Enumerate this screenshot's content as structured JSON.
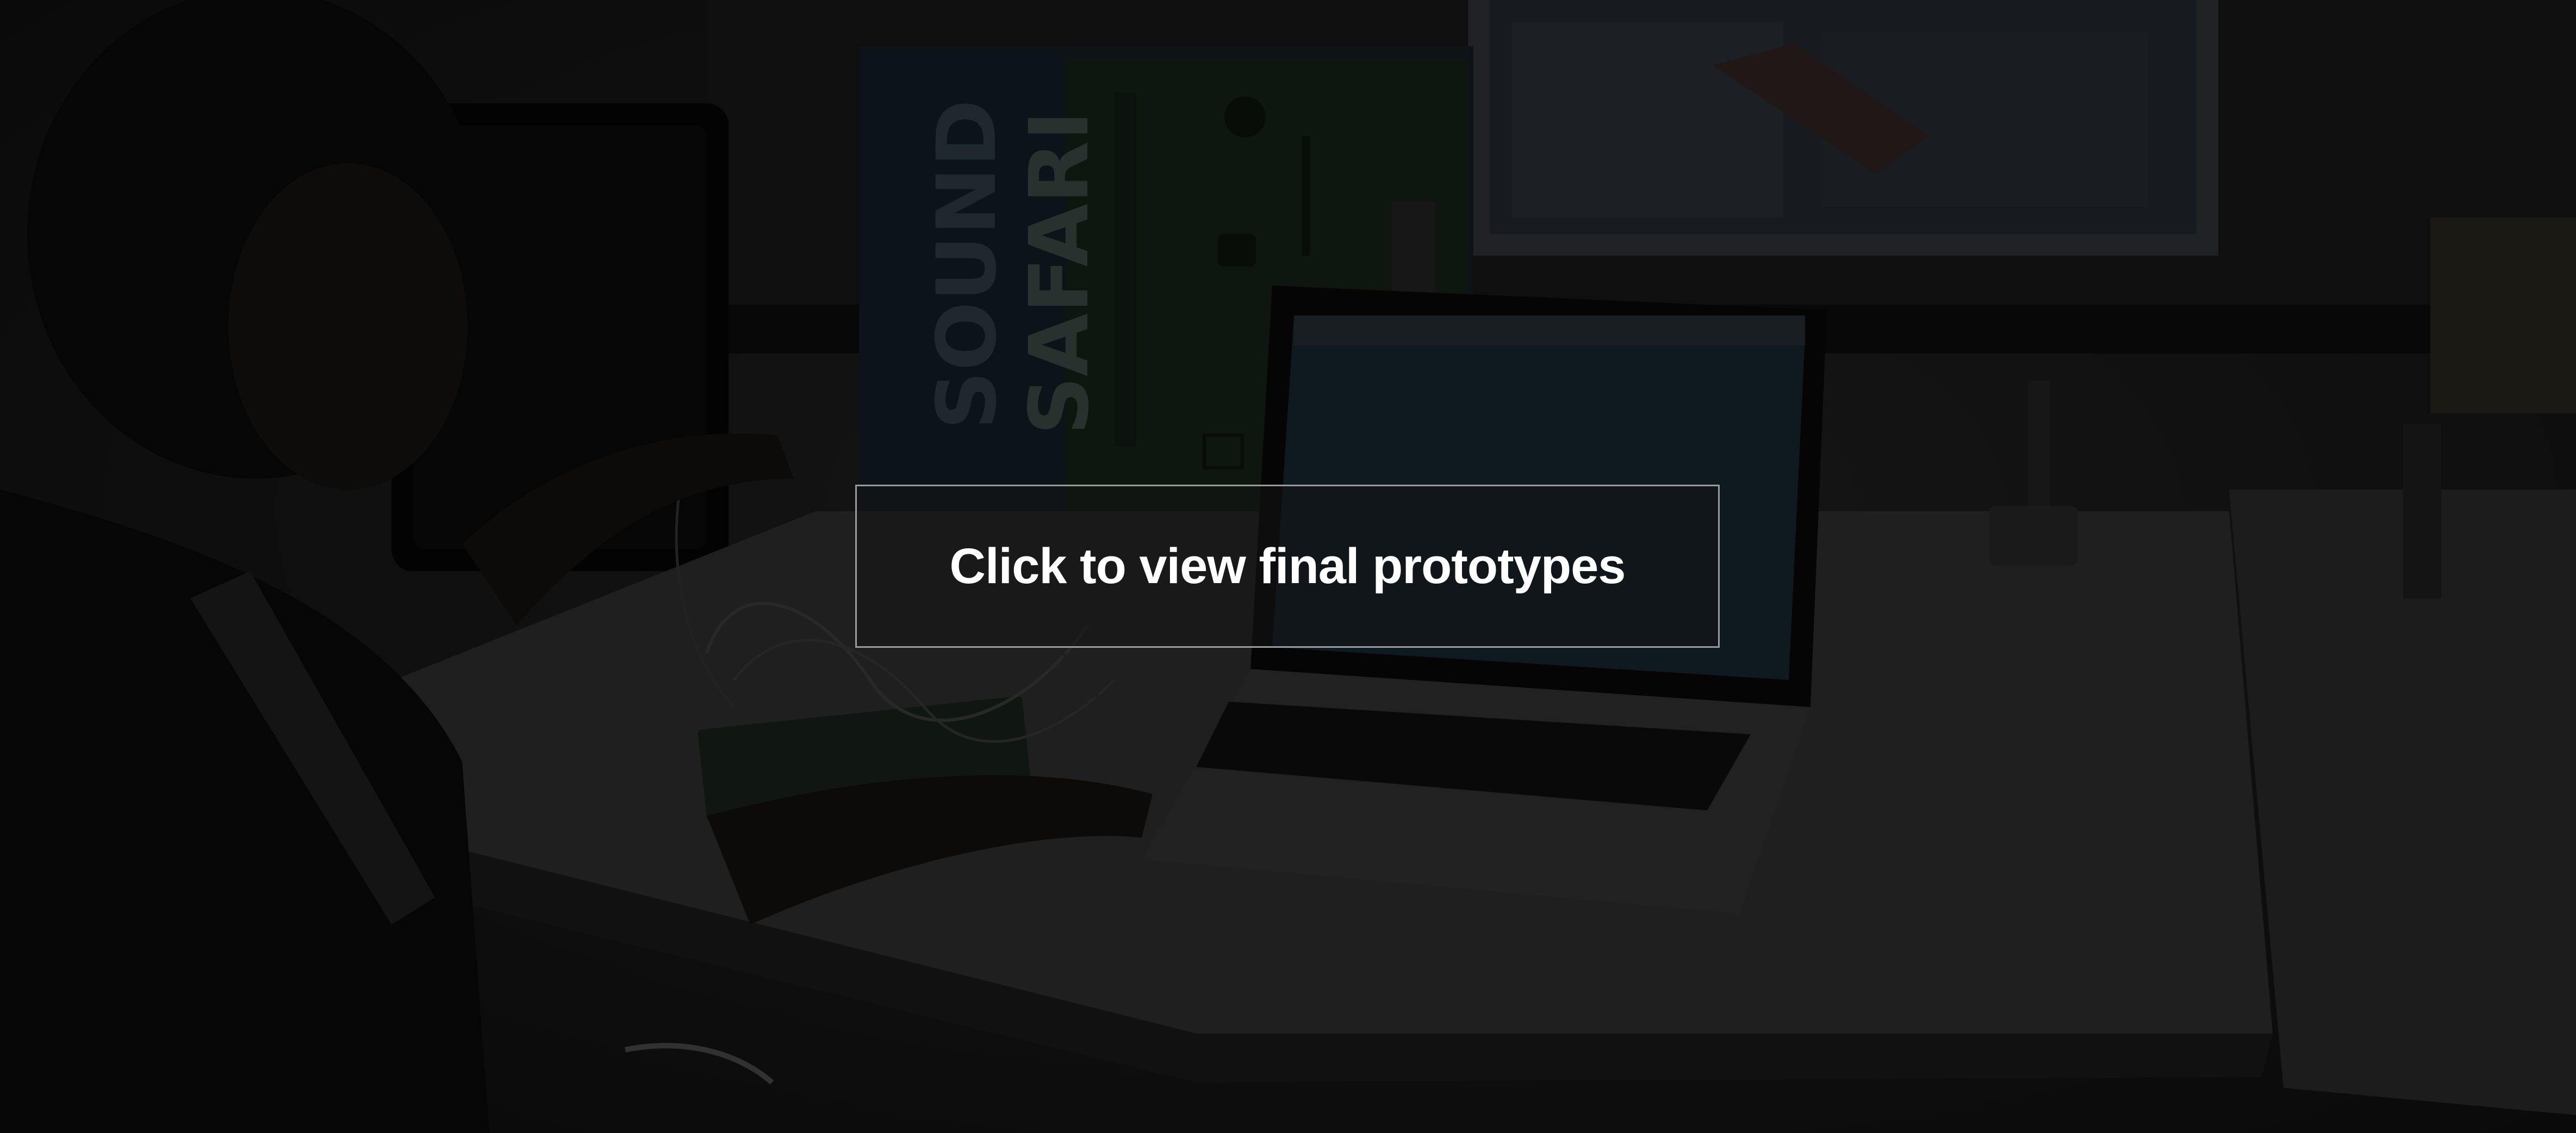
{
  "poster": {
    "title_line1": "SOUND",
    "title_line2": "SAFARI"
  },
  "cta": {
    "label": "Click to view final prototypes"
  },
  "colors": {
    "page_background": "#141414",
    "cta_text": "#ffffff",
    "cta_border": "#9a9a9a"
  }
}
